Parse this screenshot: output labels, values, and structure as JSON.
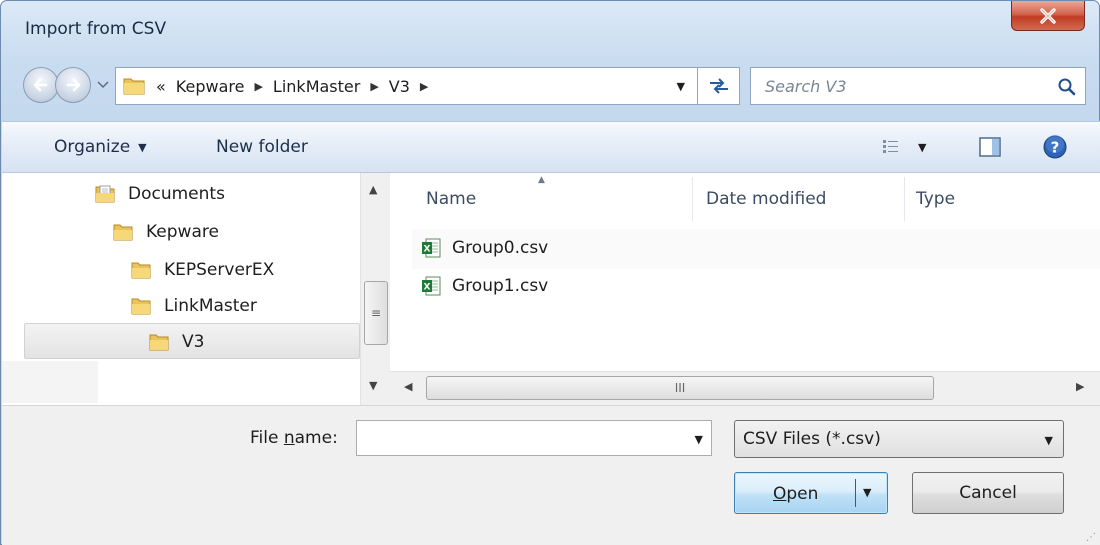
{
  "window": {
    "title": "Import from CSV",
    "close_icon": "close-icon"
  },
  "navigation": {
    "back_icon": "back-arrow-icon",
    "forward_icon": "forward-arrow-icon",
    "recent_icon": "chevron-down-icon",
    "address": {
      "overflow": "«",
      "crumbs": [
        "Kepware",
        "LinkMaster",
        "V3"
      ],
      "refresh_icon": "refresh-icon"
    },
    "search": {
      "placeholder": "Search V3",
      "icon": "search-icon"
    }
  },
  "toolbar": {
    "organize": "Organize",
    "new_folder": "New folder",
    "view_icon": "details-view-icon",
    "preview_icon": "preview-pane-icon",
    "help_icon": "help-icon"
  },
  "tree": {
    "items": [
      {
        "label": "Documents",
        "icon": "documents-folder-icon"
      },
      {
        "label": "Kepware",
        "icon": "folder-icon"
      },
      {
        "label": "KEPServerEX",
        "icon": "folder-icon"
      },
      {
        "label": "LinkMaster",
        "icon": "folder-icon"
      },
      {
        "label": "V3",
        "icon": "folder-icon",
        "selected": true
      }
    ]
  },
  "file_list": {
    "columns": [
      "Name",
      "Date modified",
      "Type"
    ],
    "files": [
      {
        "name": "Group0.csv",
        "icon": "excel-csv-icon"
      },
      {
        "name": "Group1.csv",
        "icon": "excel-csv-icon"
      }
    ],
    "scroll_thumb_glyph": "III",
    "vscroll_thumb_glyph": "≡"
  },
  "footer": {
    "file_name_label_pre": "File ",
    "file_name_label_mnemonic": "n",
    "file_name_label_post": "ame:",
    "file_name_value": "",
    "filter": "CSV Files (*.csv)",
    "open_mnemonic": "O",
    "open_rest": "pen",
    "cancel": "Cancel"
  },
  "colors": {
    "frame": "#c9dcf0",
    "close_button": "#c13b22",
    "selected_row": "#e3e3e3",
    "primary_button_border": "#3c7fb1"
  }
}
